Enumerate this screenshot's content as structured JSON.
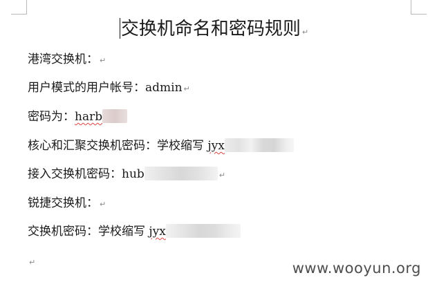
{
  "document": {
    "title": "交换机命名和密码规则",
    "paragraph_mark": "↵",
    "lines": [
      {
        "label": "港湾交换机："
      },
      {
        "label": "用户模式的用户帐号：",
        "value": "admin"
      },
      {
        "label": "密码为：",
        "value": "harb"
      },
      {
        "label": "核心和汇聚交换机密码：学校缩写 ",
        "value": "jyx"
      },
      {
        "label": "接入交换机密码：",
        "value": "hub"
      },
      {
        "label": "锐捷交换机："
      },
      {
        "label": "交换机密码：学校缩写 ",
        "value": "jyx"
      }
    ]
  },
  "watermark": "www.wooyun.org"
}
